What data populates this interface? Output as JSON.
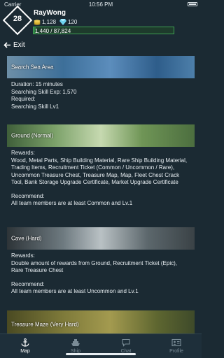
{
  "status_bar": {
    "carrier": "Carrier",
    "time": "10:56 PM"
  },
  "player": {
    "level": "28",
    "name": "RayWong",
    "coins": "1,128",
    "gems": "120",
    "exp_text": "1,440 / 87,824",
    "exp_fraction": 0.016
  },
  "nav": {
    "exit_label": "Exit"
  },
  "areas": [
    {
      "title": "Search Sea Area",
      "lines": [
        "Duration: 15 minutes",
        "Searching Skill Exp: 1,570",
        "Required:",
        "Searching Skill Lv1"
      ]
    },
    {
      "title": "Ground (Normal)",
      "rewards_label": "Rewards:",
      "rewards": "Wood, Metal Parts, Ship Building Material, Rare Ship Building Material, Trading Items, Recruitment Ticket (Common / Uncommon / Rare), Uncommon Treasure Chest, Treasure Map, Map, Fleet Chest Crack Tool, Bank Storage Upgrade Certificate, Market Upgrade Certificate",
      "recommend_label": "Recommend:",
      "recommend": "All team members are at least Common and Lv.1"
    },
    {
      "title": "Cave (Hard)",
      "rewards_label": "Rewards:",
      "rewards": "Double amount of rewards from Ground, Recruitment Ticket (Epic), Rare Treasure Chest",
      "recommend_label": "Recommend:",
      "recommend": "All team members are at least Uncommon and Lv.1"
    },
    {
      "title": "Treasure Maze (Very Hard)"
    }
  ],
  "tabs": [
    {
      "label": "Map",
      "icon": "anchor-icon",
      "active": true
    },
    {
      "label": "Ship",
      "icon": "ship-icon",
      "active": false
    },
    {
      "label": "Chat",
      "icon": "chat-icon",
      "active": false
    },
    {
      "label": "Profile",
      "icon": "profile-card-icon",
      "active": false
    }
  ],
  "colors": {
    "background": "#1b2a33",
    "exp_bar": "#2f7d43",
    "active_tab": "#ffffff",
    "inactive_tab": "#7a8c97"
  }
}
